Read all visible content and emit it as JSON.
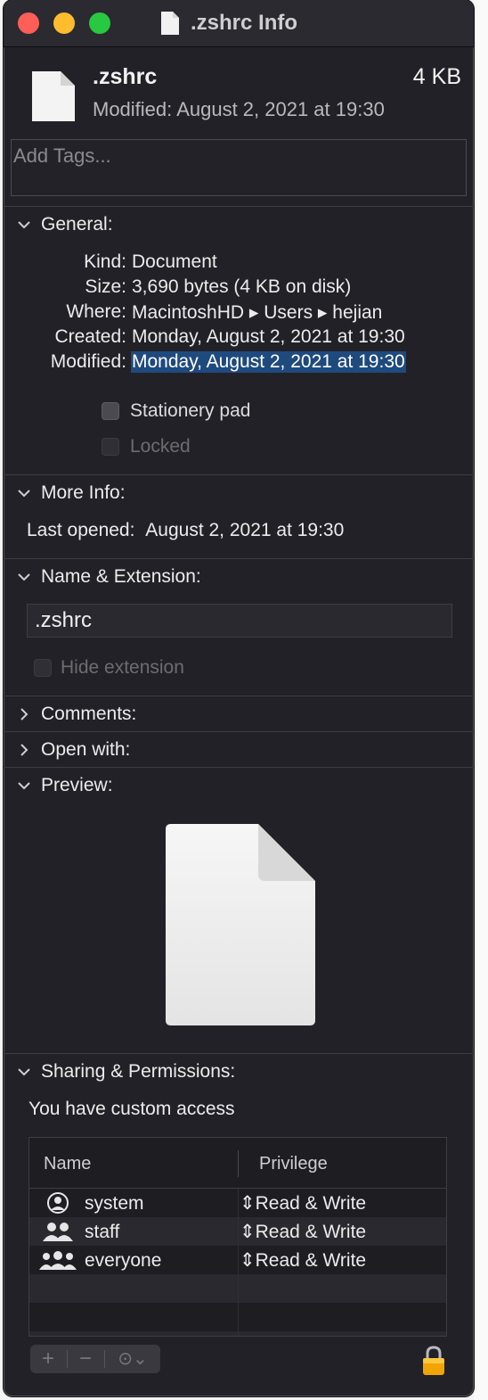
{
  "window": {
    "title": ".zshrc Info"
  },
  "header": {
    "name": ".zshrc",
    "size": "4 KB",
    "modified_label": "Modified:",
    "modified_value": "August 2, 2021 at 19:30"
  },
  "tags": {
    "placeholder": "Add Tags..."
  },
  "general": {
    "title": "General:",
    "rows": [
      {
        "label": "Kind:",
        "value": "Document"
      },
      {
        "label": "Size:",
        "value": "3,690 bytes (4 KB on disk)"
      },
      {
        "label": "Where:",
        "value": "MacintoshHD ▸ Users ▸ hejian"
      },
      {
        "label": "Created:",
        "value": "Monday, August 2, 2021 at 19:30"
      },
      {
        "label": "Modified:",
        "value": "Monday, August 2, 2021 at 19:30"
      }
    ],
    "stationery_label": "Stationery pad",
    "locked_label": "Locked"
  },
  "more_info": {
    "title": "More Info:",
    "last_opened_label": "Last opened:",
    "last_opened_value": "August 2, 2021 at 19:30"
  },
  "name_ext": {
    "title": "Name & Extension:",
    "value": ".zshrc",
    "hide_label": "Hide extension"
  },
  "comments": {
    "title": "Comments:"
  },
  "open_with": {
    "title": "Open with:"
  },
  "preview": {
    "title": "Preview:"
  },
  "sharing": {
    "title": "Sharing & Permissions:",
    "access_text": "You have custom access",
    "col_name": "Name",
    "col_privilege": "Privilege",
    "rows": [
      {
        "name": "system",
        "privilege": "Read & Write",
        "icon": "user-circle-icon"
      },
      {
        "name": "staff",
        "privilege": "Read & Write",
        "icon": "group-icon"
      },
      {
        "name": "everyone",
        "privilege": "Read & Write",
        "icon": "everyone-icon"
      }
    ]
  },
  "buttons": {
    "add": "+",
    "remove": "−",
    "more": "⊙⌄"
  },
  "colors": {
    "window_bg": "#222127",
    "selection": "#1f4a7e",
    "accent_lock": "#f0a500"
  }
}
